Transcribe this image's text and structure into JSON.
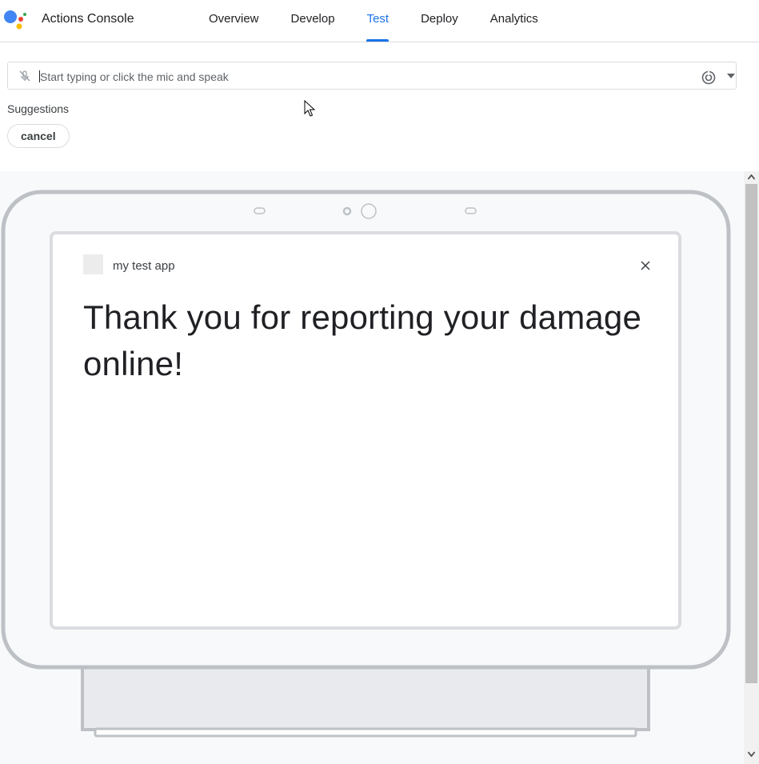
{
  "header": {
    "app_title": "Actions Console",
    "tabs": [
      {
        "label": "Overview",
        "active": false
      },
      {
        "label": "Develop",
        "active": false
      },
      {
        "label": "Test",
        "active": true
      },
      {
        "label": "Deploy",
        "active": false
      },
      {
        "label": "Analytics",
        "active": false
      }
    ],
    "accent_color": "#1a73e8"
  },
  "query": {
    "placeholder": "Start typing or click the mic and speak",
    "value": ""
  },
  "suggestions": {
    "label": "Suggestions",
    "chips": [
      "cancel"
    ]
  },
  "simulator": {
    "app_name": "my test app",
    "response": "Thank you for reporting your damage online!"
  },
  "icons": {
    "logo": "google-assistant-logo",
    "mic": "mic-off-icon",
    "assistant": "assistant-icon",
    "dropdown": "chevron-down-icon",
    "close": "close-icon"
  }
}
